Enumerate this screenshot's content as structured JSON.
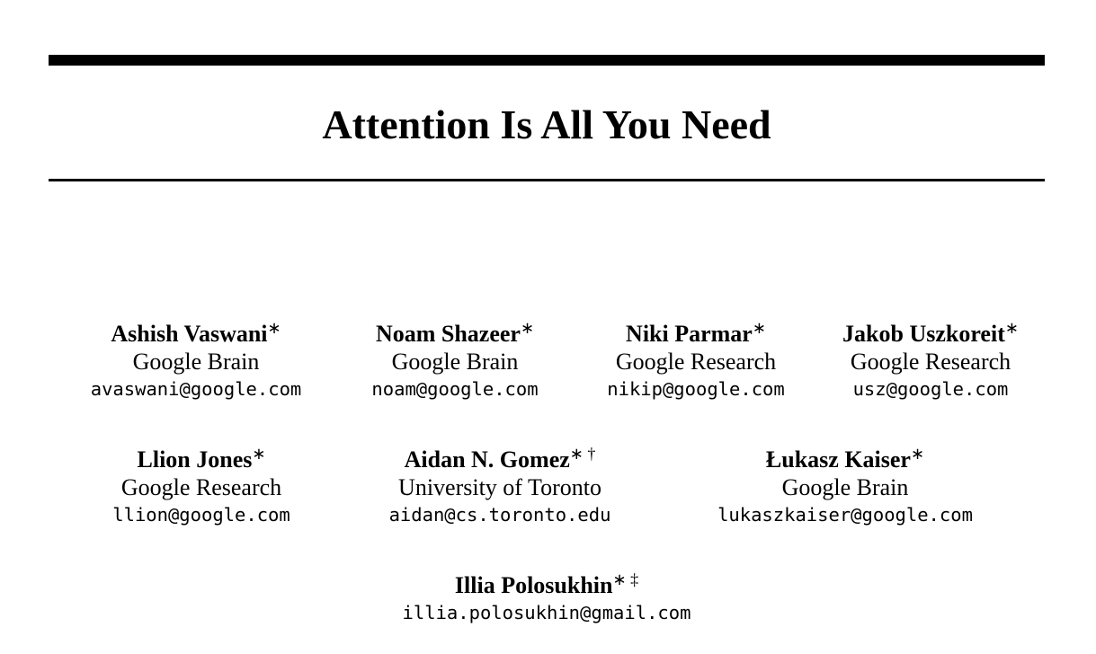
{
  "paper": {
    "title": "Attention Is All You Need"
  },
  "authors": [
    {
      "name": "Ashish Vaswani",
      "marks": "∗",
      "affiliation": "Google Brain",
      "email": "avaswani@google.com"
    },
    {
      "name": "Noam Shazeer",
      "marks": "∗",
      "affiliation": "Google Brain",
      "email": "noam@google.com"
    },
    {
      "name": "Niki Parmar",
      "marks": "∗",
      "affiliation": "Google Research",
      "email": "nikip@google.com"
    },
    {
      "name": "Jakob Uszkoreit",
      "marks": "∗",
      "affiliation": "Google Research",
      "email": "usz@google.com"
    },
    {
      "name": "Llion Jones",
      "marks": "∗",
      "affiliation": "Google Research",
      "email": "llion@google.com"
    },
    {
      "name": "Aidan N. Gomez",
      "marks": "∗ †",
      "affiliation": "University of Toronto",
      "email": "aidan@cs.toronto.edu"
    },
    {
      "name": "Łukasz Kaiser",
      "marks": "∗",
      "affiliation": "Google Brain",
      "email": "lukaszkaiser@google.com"
    },
    {
      "name": "Illia Polosukhin",
      "marks": "∗ ‡",
      "affiliation": "",
      "email": "illia.polosukhin@gmail.com"
    }
  ]
}
